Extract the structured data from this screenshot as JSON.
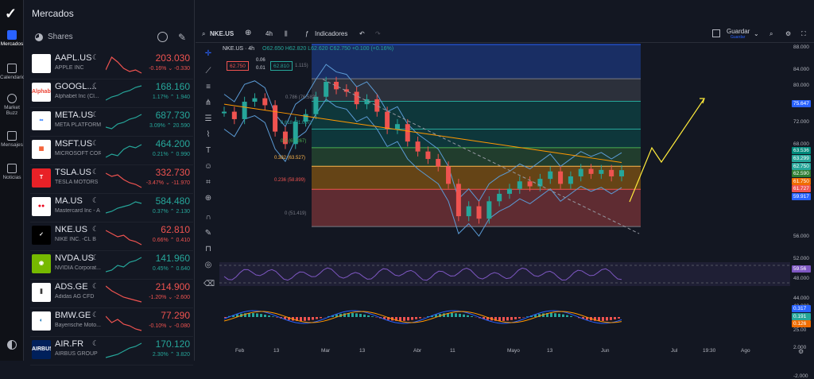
{
  "nav": {
    "items": [
      {
        "label": "Mercados",
        "icon": "home-icon"
      },
      {
        "label": "Calendario",
        "icon": "calendar-icon"
      },
      {
        "label": "Market Buzz",
        "icon": "buzz-icon"
      },
      {
        "label": "Mensajes",
        "icon": "messages-icon"
      },
      {
        "label": "Noticias",
        "icon": "news-icon"
      }
    ]
  },
  "panel": {
    "title": "Mercados",
    "section": "Shares"
  },
  "watchlist": [
    {
      "symbol": "AAPL.US",
      "name": "APPLE INC",
      "price": "203.030",
      "change": "-0.16% ⌄ -0.330",
      "dir": "down",
      "logo": "",
      "logo_bg": "#ffffff",
      "logo_fg": "#000000"
    },
    {
      "symbol": "GOOGL....",
      "name": "Alphabet Inc (Cl...",
      "price": "168.160",
      "change": "1.17% ⌃ 1.940",
      "dir": "up",
      "logo": "Alphabet",
      "logo_bg": "#ffffff",
      "logo_fg": "#ea4335"
    },
    {
      "symbol": "META.US",
      "name": "META PLATFORM...",
      "price": "687.730",
      "change": "3.09% ⌃ 20.590",
      "dir": "up",
      "logo": "∞",
      "logo_bg": "#ffffff",
      "logo_fg": "#0866ff"
    },
    {
      "symbol": "MSFT.US",
      "name": "MICROSOFT CORP",
      "price": "464.200",
      "change": "0.21% ⌃ 0.990",
      "dir": "up",
      "logo": "▦",
      "logo_bg": "#ffffff",
      "logo_fg": "#f25022"
    },
    {
      "symbol": "TSLA.US",
      "name": "TESLA MOTORS",
      "price": "332.730",
      "change": "-3.47% ⌄ -11.970",
      "dir": "down",
      "logo": "T",
      "logo_bg": "#e82127",
      "logo_fg": "#ffffff"
    },
    {
      "symbol": "MA.US",
      "name": "Mastercard Inc - A",
      "price": "584.480",
      "change": "0.37% ⌃ 2.130",
      "dir": "up",
      "logo": "●●",
      "logo_bg": "#ffffff",
      "logo_fg": "#eb001b"
    },
    {
      "symbol": "NKE.US",
      "name": "NIKE INC. -CL B",
      "price": "62.810",
      "change": "0.66% ⌃ 0.410",
      "dir": "down",
      "logo": "✓",
      "logo_bg": "#000000",
      "logo_fg": "#ffffff"
    },
    {
      "symbol": "NVDA.US",
      "name": "NVIDIA Corporat...",
      "price": "141.960",
      "change": "0.45% ⌃ 0.640",
      "dir": "up",
      "logo": "◉",
      "logo_bg": "#76b900",
      "logo_fg": "#ffffff"
    },
    {
      "symbol": "ADS.GE",
      "name": "Adidas AG CFD",
      "price": "214.900",
      "change": "-1.20% ⌄ -2.600",
      "dir": "down",
      "logo": "⫼",
      "logo_bg": "#ffffff",
      "logo_fg": "#000000"
    },
    {
      "symbol": "BMW.GE",
      "name": "Bayerische Moto...",
      "price": "77.290",
      "change": "-0.10% ⌄ -0.080",
      "dir": "down",
      "logo": "◐",
      "logo_bg": "#ffffff",
      "logo_fg": "#0066b1"
    },
    {
      "symbol": "AIR.FR",
      "name": "AIRBUS GROUP",
      "price": "170.120",
      "change": "2.30% ⌃ 3.820",
      "dir": "up",
      "logo": "AIRBUS",
      "logo_bg": "#00205b",
      "logo_fg": "#ffffff"
    }
  ],
  "toolbar": {
    "symbol": "NKE.US",
    "interval": "4h",
    "indicators": "Indicadores",
    "save": "Guardar",
    "save_sub": "Guardar"
  },
  "legend": {
    "title": "NKE.US · 4h",
    "ohlc": "O62.650 H62.820 L62.620 C62.750 +0.100 (+0.16%)",
    "bid": "62.750",
    "spread_top": "0.06",
    "spread_bot": "0.01",
    "ask": "62.810"
  },
  "fib_labels": [
    {
      "text": "0.786 (76.582)",
      "color": "#787b86"
    },
    {
      "text": "0.618 (71.007)",
      "color": "#26a69a"
    },
    {
      "text": "0.5 (67.267)",
      "color": "#4caf50"
    },
    {
      "text": "0.382 (63.527)",
      "color": "#ffb74d"
    },
    {
      "text": "0.236 (58.899)",
      "color": "#ef5350"
    },
    {
      "text": "0 (51.419)",
      "color": "#787b86"
    },
    {
      "text": "1.115)",
      "color": "#787b86"
    }
  ],
  "yaxis": {
    "labels": [
      "88.000",
      "84.000",
      "80.000",
      "72.000",
      "68.000",
      "56.000",
      "52.000",
      "48.000",
      "44.000",
      "40.000",
      "25.00",
      "2.000",
      "-2.000"
    ],
    "tags": [
      {
        "text": "75.647",
        "color": "#2962ff"
      },
      {
        "text": "63.536",
        "color": "#00897b"
      },
      {
        "text": "63.299",
        "color": "#26a69a"
      },
      {
        "text": "62.750",
        "color": "#26a69a"
      },
      {
        "text": "62.590",
        "color": "#2e7d32"
      },
      {
        "text": "61.750",
        "color": "#ef6c00"
      },
      {
        "text": "61.727",
        "color": "#ef5350"
      },
      {
        "text": "59.917",
        "color": "#2962ff"
      },
      {
        "text": "59.56",
        "color": "#7e57c2"
      },
      {
        "text": "0.317",
        "color": "#2962ff"
      },
      {
        "text": "0.191",
        "color": "#26a69a"
      },
      {
        "text": "0.126",
        "color": "#ef6c00"
      }
    ]
  },
  "xaxis": {
    "labels": [
      "Feb",
      "13",
      "Mar",
      "13",
      "Abr",
      "11",
      "Mayo",
      "13",
      "Jun",
      "Jul",
      "19:30",
      "Ago"
    ]
  },
  "chart_data": {
    "type": "line",
    "title": "NKE.US · 4h",
    "series": [
      {
        "name": "NKE.US",
        "values": [
          74.5,
          73.0,
          76.5,
          77.2,
          75.8,
          70.5,
          68.0,
          72.5,
          74.0,
          77.5,
          80.5,
          79.0,
          78.5,
          76.0,
          77.0,
          74.5,
          71.0,
          72.0,
          68.5,
          66.5,
          65.0,
          63.5,
          60.0,
          53.5,
          55.5,
          53.0,
          56.5,
          58.0,
          59.0,
          60.5,
          59.5,
          61.0,
          62.5,
          60.0,
          61.5,
          63.0,
          62.0,
          62.8,
          61.5,
          62.75
        ]
      }
    ],
    "ylim": [
      44,
      88
    ],
    "fib_levels": [
      51.419,
      58.899,
      63.527,
      67.267,
      71.007,
      76.582,
      81.115,
      88.0
    ],
    "rsi": 59.56,
    "macd": [
      0.317,
      0.191,
      0.126
    ]
  }
}
